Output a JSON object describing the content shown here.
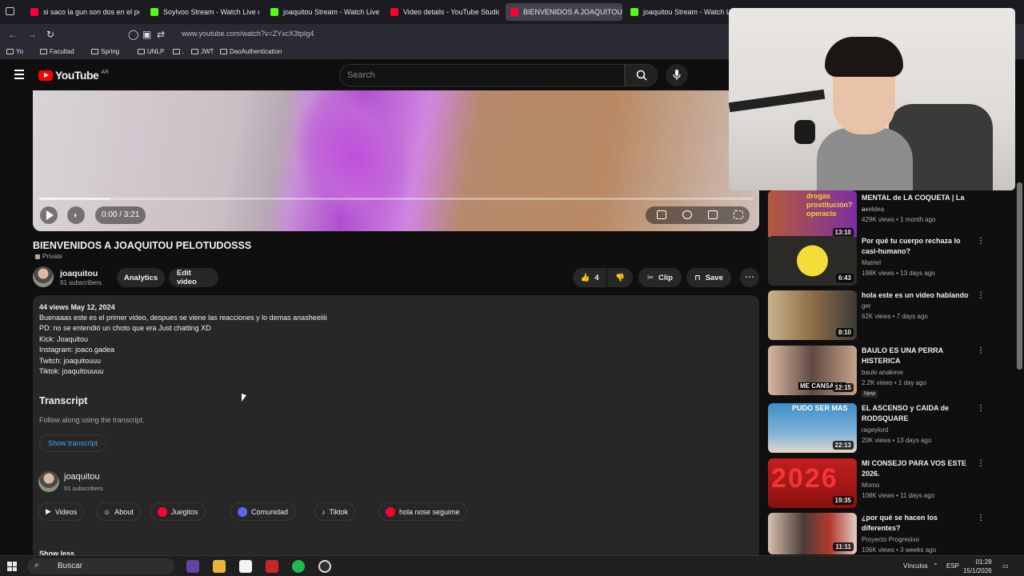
{
  "browser": {
    "tabs": [
      {
        "label": "si saco la gun son dos en el pe",
        "active": false,
        "color": "#ff0033"
      },
      {
        "label": "Soylvoo Stream - Watch Live o",
        "active": false,
        "color": "#53fc18"
      },
      {
        "label": "joaquitou Stream - Watch Live",
        "active": false,
        "color": "#53fc18"
      },
      {
        "label": "Video details - YouTube Studio",
        "active": false,
        "color": "#ff0033"
      },
      {
        "label": "BIENVENIDOS A JOAQUITOU P",
        "active": true,
        "color": "#ff0033"
      },
      {
        "label": "joaquitou Stream - Watch Live",
        "active": false,
        "color": "#53fc18"
      }
    ],
    "url": "www.youtube.com/watch?v=ZYxcX3tpIg4",
    "bookmarks": [
      "Yo",
      "Facultad",
      "Spring",
      "UNLP",
      ".",
      "JWT",
      "DaoAuthentication"
    ]
  },
  "youtube": {
    "logo_text": "YouTube",
    "country": "AR",
    "search_placeholder": "Search"
  },
  "player": {
    "time": "0:00 / 3:21",
    "progress_fraction": 0
  },
  "video": {
    "title": "BIENVENIDOS A JOAQUITOU PELOTUDOSSS",
    "privacy": "Private",
    "channel": "joaquitou",
    "subscribers": "91 subscribers",
    "analytics_label": "Analytics",
    "edit_label": "Edit video",
    "likes": "4",
    "clip_label": "Clip",
    "save_label": "Save"
  },
  "description": {
    "meta": "44 views  May 12, 2024",
    "lines": [
      "Buenaaas este es el primer video, despues se viene las reacciones y lo demas anasheeiiii",
      "PD: no se entendió un choto que era Just chatting XD",
      "Kick: Joaquitou",
      "Instagram: joaco.gadea",
      "Twitch: joaquitouuu",
      "Tiktok: joaquitouuuu"
    ],
    "transcript_heading": "Transcript",
    "transcript_text": "Follow along using the transcript.",
    "transcript_button": "Show transcript",
    "channel": "joaquitou",
    "subscribers": "91 subscribers",
    "links": [
      "Videos",
      "About",
      "Juegitos",
      "Comunidad",
      "Tiktok",
      "hola nose seguime"
    ],
    "show_less": "Show less"
  },
  "suggestions": [
    {
      "title": "MENTAL de LA COQUETA | La ...",
      "channel": "axeldea",
      "meta": "429K views • 1 month ago",
      "duration": "13:10",
      "color": "#b45a3a",
      "overlay": "drogas prostitución? operacio"
    },
    {
      "title": "Por qué tu cuerpo rechaza lo casi-humano?",
      "channel": "Matriel",
      "meta": "198K views • 13 days ago",
      "duration": "6:43",
      "color": "#e0c72a",
      "overlay": ""
    },
    {
      "title": "hola este es un video hablando",
      "channel": "ger",
      "meta": "62K views • 7 days ago",
      "duration": "8:10",
      "color": "#a58a62",
      "overlay": ""
    },
    {
      "title": "BAULO ES UNA PERRA HISTERICA",
      "channel": "baulo anakeve",
      "meta": "2.2K views • 1 day ago",
      "duration": "12:15",
      "color": "#7a6a60",
      "overlay": "ME CANSARO",
      "badge": "New"
    },
    {
      "title": "EL ASCENSO y CAIDA de RODSQUARE",
      "channel": "rageylord",
      "meta": "20K views • 13 days ago",
      "duration": "22:13",
      "color": "#3e8fc7",
      "overlay": "PUDO SER MAS"
    },
    {
      "title": "MI CONSEJO PARA VOS ESTE 2026.",
      "channel": "Momo",
      "meta": "108K views • 11 days ago",
      "duration": "19:35",
      "color": "#c21f1f",
      "overlay": "2026"
    },
    {
      "title": "¿por qué se hacen los diferentes?",
      "channel": "Proyecto Progresivo",
      "meta": "106K views • 3 weeks ago",
      "duration": "11:11",
      "color": "#6a5a58",
      "overlay": ""
    }
  ],
  "taskbar": {
    "search_label": "Buscar",
    "links_label": "Vínculos",
    "lang": "ESP",
    "time": "01:28",
    "date": "15/1/2026"
  }
}
